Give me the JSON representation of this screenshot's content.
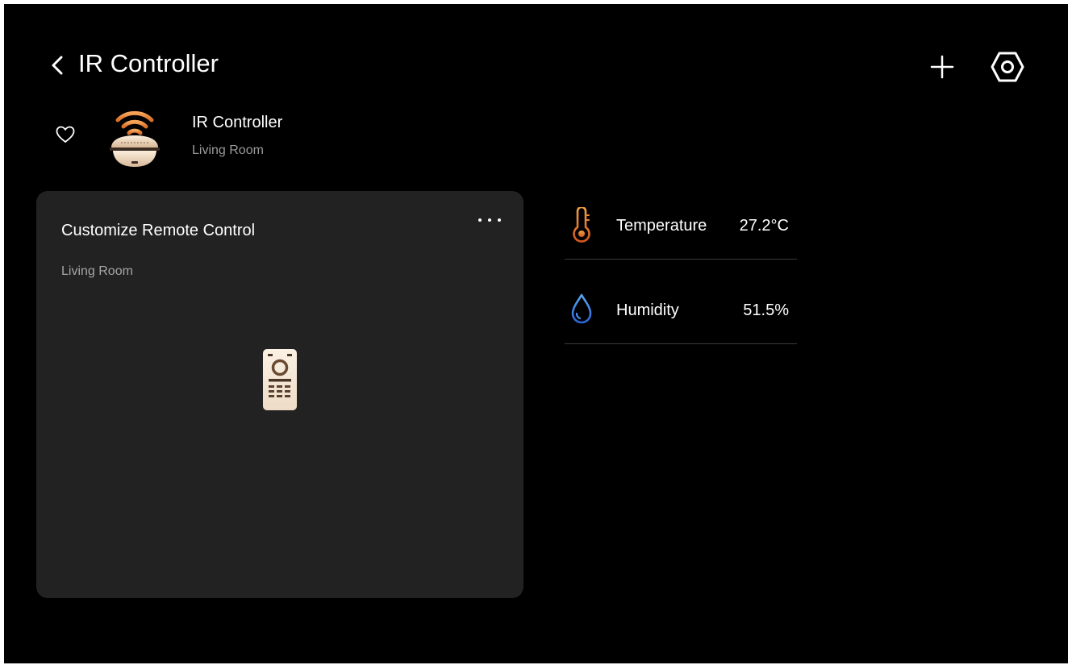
{
  "header": {
    "title": "IR Controller",
    "back_icon": "chevron-left-icon",
    "add_icon": "plus-icon",
    "settings_icon": "hexagon-settings-icon"
  },
  "device": {
    "name": "IR Controller",
    "room": "Living Room",
    "favorite": false,
    "icon": "ir-blaster-icon"
  },
  "remote_card": {
    "title": "Customize Remote Control",
    "room": "Living Room",
    "icon": "remote-control-icon"
  },
  "sensors": [
    {
      "label": "Temperature",
      "value": "27.2°C",
      "icon": "thermometer-icon",
      "color": "#e07a2e"
    },
    {
      "label": "Humidity",
      "value": "51.5%",
      "icon": "water-drop-icon",
      "color": "#3d8be8"
    }
  ],
  "colors": {
    "background": "#000000",
    "card": "#222222",
    "accent_orange": "#e98a3c",
    "device_beige": "#f1dcc0",
    "secondary_text": "#9a9a9a"
  }
}
